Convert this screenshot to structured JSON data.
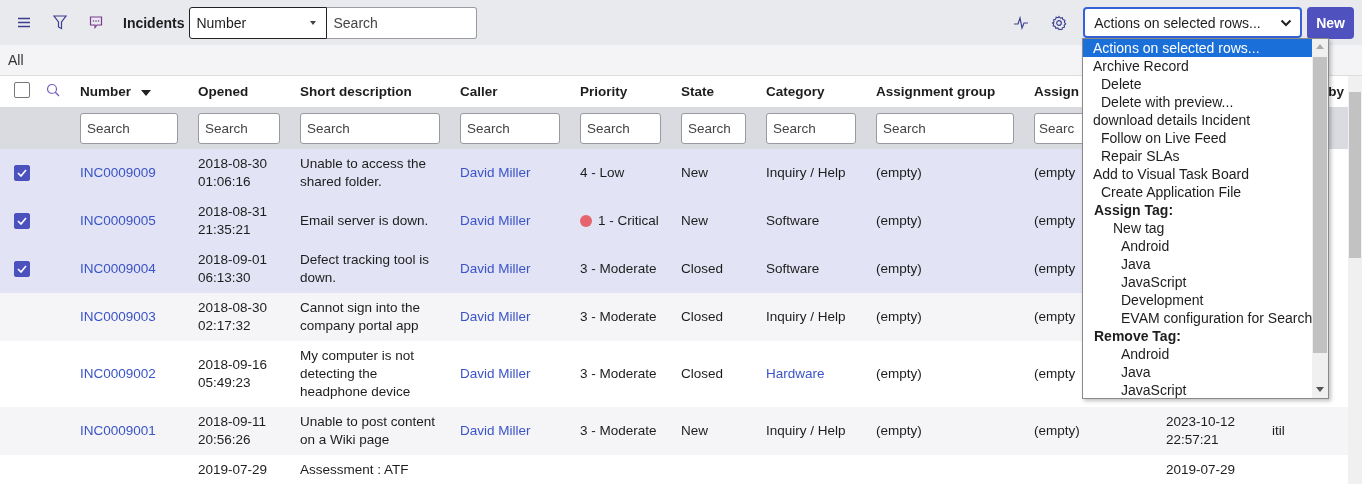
{
  "toolbar": {
    "title": "Incidents",
    "field_select": "Number",
    "search": {
      "placeholder": "Search"
    },
    "actions_select": "Actions on selected rows...",
    "new_button": "New"
  },
  "breadcrumb": "All",
  "table": {
    "select_all": {
      "checked": false
    },
    "columns": [
      {
        "label": "Number",
        "sorted": true,
        "kind": "link",
        "placeholder": "Search"
      },
      {
        "label": "Opened",
        "sorted": false,
        "kind": "text",
        "placeholder": "Search"
      },
      {
        "label": "Short description",
        "sorted": false,
        "kind": "text",
        "placeholder": "Search"
      },
      {
        "label": "Caller",
        "sorted": false,
        "kind": "link",
        "placeholder": "Search"
      },
      {
        "label": "Priority",
        "sorted": false,
        "kind": "text",
        "placeholder": "Search"
      },
      {
        "label": "State",
        "sorted": false,
        "kind": "text",
        "placeholder": "Search"
      },
      {
        "label": "Category",
        "sorted": false,
        "kind": "text",
        "placeholder": "Search"
      },
      {
        "label": "Assignment group",
        "sorted": false,
        "kind": "text",
        "placeholder": "Search"
      },
      {
        "label": "Assign",
        "kind": "text",
        "placeholder": "Searc"
      },
      {
        "kind": "text"
      },
      {
        "label": "by",
        "sorted": false,
        "kind": "text"
      }
    ],
    "rows": [
      {
        "checked": true,
        "cells": [
          "INC0009009",
          "2018-08-30 01:06:16",
          "Unable to access the shared folder.",
          "David Miller",
          "4 - Low",
          "New",
          "Inquiry / Help",
          "(empty)",
          "(empty"
        ]
      },
      {
        "checked": true,
        "cells": [
          "INC0009005",
          "2018-08-31 21:35:21",
          "Email server is down.",
          "David Miller",
          {
            "text": "1 - Critical",
            "color": "#e5646e"
          },
          "New",
          "Software",
          "(empty)",
          "(empty"
        ]
      },
      {
        "checked": true,
        "cells": [
          "INC0009004",
          "2018-09-01 06:13:30",
          "Defect tracking tool is down.",
          "David Miller",
          "3 - Moderate",
          "Closed",
          "Software",
          "(empty)",
          "(empty"
        ]
      },
      {
        "checked": false,
        "cells": [
          "INC0009003",
          "2018-08-30 02:17:32",
          "Cannot sign into the company portal app",
          "David Miller",
          "3 - Moderate",
          "Closed",
          "Inquiry / Help",
          "(empty)",
          "(empty"
        ]
      },
      {
        "checked": false,
        "cells": [
          "INC0009002",
          "2018-09-16 05:49:23",
          "My computer is not detecting the headphone device",
          "David Miller",
          "3 - Moderate",
          "Closed",
          {
            "text": "Hardware",
            "kind": "link"
          },
          "(empty)",
          "(empty"
        ]
      },
      {
        "checked": false,
        "cells": [
          "INC0009001",
          "2018-09-11 20:56:26",
          "Unable to post content on a Wiki page",
          "David Miller",
          "3 - Moderate",
          "New",
          "Inquiry / Help",
          "(empty)",
          "(empty)",
          "2023-10-12 22:57:21",
          "itil"
        ]
      },
      {
        "checked": false,
        "cells": [
          null,
          "2019-07-29",
          "Assessment : ATF",
          null,
          null,
          null,
          null,
          null,
          null,
          "2019-07-29"
        ]
      }
    ]
  },
  "actions_menu": {
    "options": [
      {
        "text": "Actions on selected rows...",
        "kind": "plain",
        "selected": true
      },
      {
        "text": "Archive Record",
        "kind": "plain",
        "selected": false
      },
      {
        "text": "Delete",
        "kind": "indented",
        "selected": false
      },
      {
        "text": "Delete with preview...",
        "kind": "indented",
        "selected": false
      },
      {
        "text": "download details Incident",
        "kind": "plain",
        "selected": false
      },
      {
        "text": "Follow on Live Feed",
        "kind": "indented",
        "selected": false
      },
      {
        "text": "Repair SLAs",
        "kind": "indented",
        "selected": false
      },
      {
        "text": "Add to Visual Task Board",
        "kind": "plain",
        "selected": false
      },
      {
        "text": "Create Application File",
        "kind": "indented",
        "selected": false
      }
    ],
    "groups": [
      {
        "label": "Assign Tag:",
        "options": [
          {
            "text": "New tag",
            "kind": "new",
            "selected": false
          },
          {
            "text": "Android",
            "kind": "tag",
            "selected": false
          },
          {
            "text": "Java",
            "kind": "tag",
            "selected": false
          },
          {
            "text": "JavaScript",
            "kind": "tag",
            "selected": false
          },
          {
            "text": "Development",
            "kind": "tag",
            "selected": false
          },
          {
            "text": "EVAM configuration for Search",
            "kind": "tag",
            "selected": false
          }
        ]
      },
      {
        "label": "Remove Tag:",
        "options": [
          {
            "text": "Android",
            "kind": "tag",
            "selected": false
          },
          {
            "text": "Java",
            "kind": "tag",
            "selected": false
          },
          {
            "text": "JavaScript",
            "kind": "tag",
            "selected": false
          }
        ]
      }
    ]
  }
}
